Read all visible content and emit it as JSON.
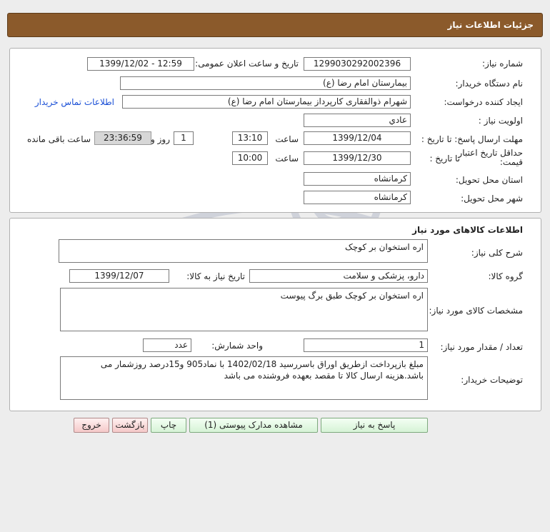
{
  "header": {
    "title": "جزئیات اطلاعات نیاز"
  },
  "info": {
    "need_number_label": "شماره نیاز:",
    "need_number": "1299030292002396",
    "announce_label": "تاریخ و ساعت اعلان عمومی:",
    "announce_value": "1399/12/02 - 12:59",
    "buyer_org_label": "نام دستگاه خریدار:",
    "buyer_org": "بیمارستان امام رضا (ع)",
    "requester_label": "ایجاد کننده درخواست:",
    "requester": "شهرام ذوالفقاری کارپرداز بیمارستان امام رضا (ع)",
    "contact_link": "اطلاعات تماس خریدار",
    "priority_label": "اولویت نیاز :",
    "priority": "عادي",
    "deadline_label": "مهلت ارسال پاسخ: تا تاریخ :",
    "deadline_date": "1399/12/04",
    "time_label": "ساعت",
    "deadline_time": "13:10",
    "days_value": "1",
    "days_label": "روز و",
    "remaining_time": "23:36:59",
    "remaining_label": "ساعت باقی مانده",
    "validity_label": "حداقل تاریخ اعتبار قیمت:",
    "validity_to_label": "تا تاریخ :",
    "validity_date": "1399/12/30",
    "validity_time_label": "ساعت",
    "validity_time": "10:00",
    "province_label": "استان محل تحویل:",
    "province": "کرمانشاه",
    "city_label": "شهر محل تحویل:",
    "city": "کرمانشاه"
  },
  "goods": {
    "section_title": "اطلاعات کالاهای مورد نیاز",
    "summary_label": "شرح کلی نیاز:",
    "summary": "اره استخوان بر کوچک",
    "group_label": "گروه کالا:",
    "group": "دارو، پزشکی و سلامت",
    "need_date_label": "تاریخ نیاز به کالا:",
    "need_date": "1399/12/07",
    "specs_label": "مشخصات کالای مورد نیاز:",
    "specs": "اره استخوان بر کوچک طبق برگ پیوست",
    "qty_label": "تعداد / مقدار مورد نیاز:",
    "qty": "1",
    "unit_label": "واحد شمارش:",
    "unit": "عدد",
    "notes_label": "توضیحات خریدار:",
    "notes": "مبلغ بازپرداخت ازطریق اوراق باسررسید 1402/02/18 با نماد905 و15درصد روزشمار می باشد.هزینه ارسال کالا تا مقصد بعهده فروشنده می باشد"
  },
  "buttons": {
    "reply": "پاسخ به نیاز",
    "attachments": "مشاهده مدارک پیوستی (1)",
    "print": "چاپ",
    "back": "بازگشت",
    "exit": "خروج"
  }
}
